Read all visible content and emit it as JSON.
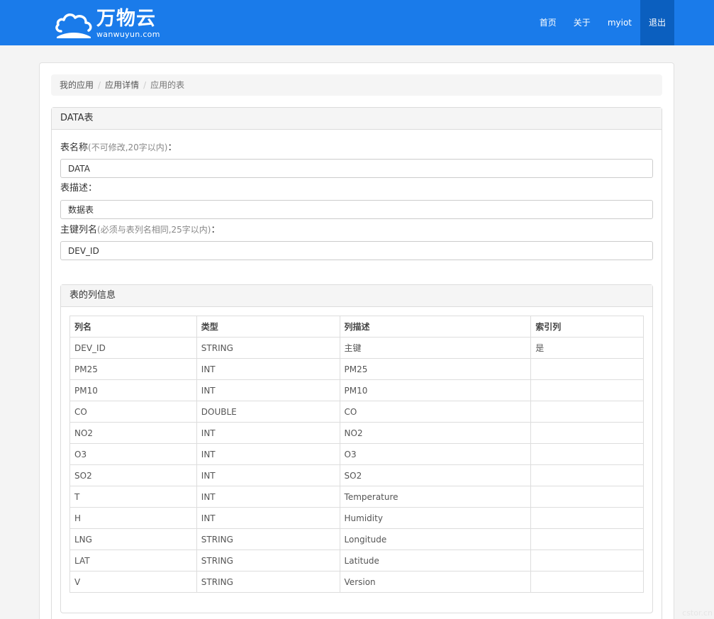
{
  "brand": {
    "name_cn": "万物云",
    "name_en": "wanwuyun.com"
  },
  "nav": [
    {
      "label": "首页",
      "active": false
    },
    {
      "label": "关于",
      "active": false
    },
    {
      "label": "myiot",
      "active": false
    },
    {
      "label": "退出",
      "active": true
    }
  ],
  "breadcrumb": {
    "items": [
      "我的应用",
      "应用详情"
    ],
    "current": "应用的表"
  },
  "panel": {
    "title": "DATA表"
  },
  "form": {
    "name": {
      "label": "表名称",
      "hint": "(不可修改,20字以内)",
      "suffix": "：",
      "value": "DATA"
    },
    "desc": {
      "label": "表描述",
      "hint": "",
      "suffix": "：",
      "value": "数据表"
    },
    "pk": {
      "label": "主键列名",
      "hint": "(必须与表列名相同,25字以内)",
      "suffix": "：",
      "value": "DEV_ID"
    }
  },
  "columns_panel": {
    "title": "表的列信息",
    "headers": [
      "列名",
      "类型",
      "列描述",
      "索引列"
    ],
    "rows": [
      [
        "DEV_ID",
        "STRING",
        "主键",
        "是"
      ],
      [
        "PM25",
        "INT",
        "PM25",
        ""
      ],
      [
        "PM10",
        "INT",
        "PM10",
        ""
      ],
      [
        "CO",
        "DOUBLE",
        "CO",
        ""
      ],
      [
        "NO2",
        "INT",
        "NO2",
        ""
      ],
      [
        "O3",
        "INT",
        "O3",
        ""
      ],
      [
        "SO2",
        "INT",
        "SO2",
        ""
      ],
      [
        "T",
        "INT",
        "Temperature",
        ""
      ],
      [
        "H",
        "INT",
        "Humidity",
        ""
      ],
      [
        "LNG",
        "STRING",
        "Longitude",
        ""
      ],
      [
        "LAT",
        "STRING",
        "Latitude",
        ""
      ],
      [
        "V",
        "STRING",
        "Version",
        ""
      ]
    ]
  },
  "watermark": "cstor.cn",
  "colors": {
    "navbar": "#1a7bea",
    "nav_active": "#0b5fbf"
  }
}
